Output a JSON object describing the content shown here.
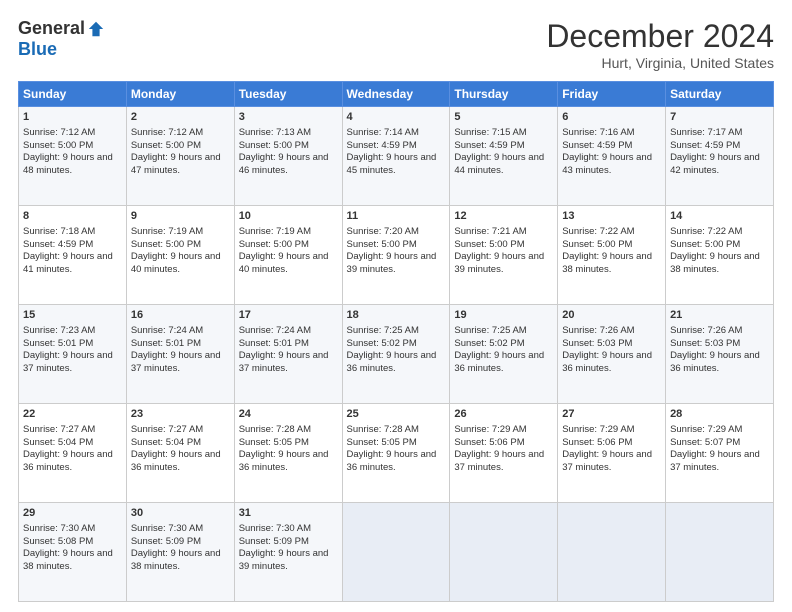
{
  "logo": {
    "general": "General",
    "blue": "Blue"
  },
  "header": {
    "month": "December 2024",
    "location": "Hurt, Virginia, United States"
  },
  "weekdays": [
    "Sunday",
    "Monday",
    "Tuesday",
    "Wednesday",
    "Thursday",
    "Friday",
    "Saturday"
  ],
  "weeks": [
    [
      {
        "day": "1",
        "sunrise": "Sunrise: 7:12 AM",
        "sunset": "Sunset: 5:00 PM",
        "daylight": "Daylight: 9 hours and 48 minutes."
      },
      {
        "day": "2",
        "sunrise": "Sunrise: 7:12 AM",
        "sunset": "Sunset: 5:00 PM",
        "daylight": "Daylight: 9 hours and 47 minutes."
      },
      {
        "day": "3",
        "sunrise": "Sunrise: 7:13 AM",
        "sunset": "Sunset: 5:00 PM",
        "daylight": "Daylight: 9 hours and 46 minutes."
      },
      {
        "day": "4",
        "sunrise": "Sunrise: 7:14 AM",
        "sunset": "Sunset: 4:59 PM",
        "daylight": "Daylight: 9 hours and 45 minutes."
      },
      {
        "day": "5",
        "sunrise": "Sunrise: 7:15 AM",
        "sunset": "Sunset: 4:59 PM",
        "daylight": "Daylight: 9 hours and 44 minutes."
      },
      {
        "day": "6",
        "sunrise": "Sunrise: 7:16 AM",
        "sunset": "Sunset: 4:59 PM",
        "daylight": "Daylight: 9 hours and 43 minutes."
      },
      {
        "day": "7",
        "sunrise": "Sunrise: 7:17 AM",
        "sunset": "Sunset: 4:59 PM",
        "daylight": "Daylight: 9 hours and 42 minutes."
      }
    ],
    [
      {
        "day": "8",
        "sunrise": "Sunrise: 7:18 AM",
        "sunset": "Sunset: 4:59 PM",
        "daylight": "Daylight: 9 hours and 41 minutes."
      },
      {
        "day": "9",
        "sunrise": "Sunrise: 7:19 AM",
        "sunset": "Sunset: 5:00 PM",
        "daylight": "Daylight: 9 hours and 40 minutes."
      },
      {
        "day": "10",
        "sunrise": "Sunrise: 7:19 AM",
        "sunset": "Sunset: 5:00 PM",
        "daylight": "Daylight: 9 hours and 40 minutes."
      },
      {
        "day": "11",
        "sunrise": "Sunrise: 7:20 AM",
        "sunset": "Sunset: 5:00 PM",
        "daylight": "Daylight: 9 hours and 39 minutes."
      },
      {
        "day": "12",
        "sunrise": "Sunrise: 7:21 AM",
        "sunset": "Sunset: 5:00 PM",
        "daylight": "Daylight: 9 hours and 39 minutes."
      },
      {
        "day": "13",
        "sunrise": "Sunrise: 7:22 AM",
        "sunset": "Sunset: 5:00 PM",
        "daylight": "Daylight: 9 hours and 38 minutes."
      },
      {
        "day": "14",
        "sunrise": "Sunrise: 7:22 AM",
        "sunset": "Sunset: 5:00 PM",
        "daylight": "Daylight: 9 hours and 38 minutes."
      }
    ],
    [
      {
        "day": "15",
        "sunrise": "Sunrise: 7:23 AM",
        "sunset": "Sunset: 5:01 PM",
        "daylight": "Daylight: 9 hours and 37 minutes."
      },
      {
        "day": "16",
        "sunrise": "Sunrise: 7:24 AM",
        "sunset": "Sunset: 5:01 PM",
        "daylight": "Daylight: 9 hours and 37 minutes."
      },
      {
        "day": "17",
        "sunrise": "Sunrise: 7:24 AM",
        "sunset": "Sunset: 5:01 PM",
        "daylight": "Daylight: 9 hours and 37 minutes."
      },
      {
        "day": "18",
        "sunrise": "Sunrise: 7:25 AM",
        "sunset": "Sunset: 5:02 PM",
        "daylight": "Daylight: 9 hours and 36 minutes."
      },
      {
        "day": "19",
        "sunrise": "Sunrise: 7:25 AM",
        "sunset": "Sunset: 5:02 PM",
        "daylight": "Daylight: 9 hours and 36 minutes."
      },
      {
        "day": "20",
        "sunrise": "Sunrise: 7:26 AM",
        "sunset": "Sunset: 5:03 PM",
        "daylight": "Daylight: 9 hours and 36 minutes."
      },
      {
        "day": "21",
        "sunrise": "Sunrise: 7:26 AM",
        "sunset": "Sunset: 5:03 PM",
        "daylight": "Daylight: 9 hours and 36 minutes."
      }
    ],
    [
      {
        "day": "22",
        "sunrise": "Sunrise: 7:27 AM",
        "sunset": "Sunset: 5:04 PM",
        "daylight": "Daylight: 9 hours and 36 minutes."
      },
      {
        "day": "23",
        "sunrise": "Sunrise: 7:27 AM",
        "sunset": "Sunset: 5:04 PM",
        "daylight": "Daylight: 9 hours and 36 minutes."
      },
      {
        "day": "24",
        "sunrise": "Sunrise: 7:28 AM",
        "sunset": "Sunset: 5:05 PM",
        "daylight": "Daylight: 9 hours and 36 minutes."
      },
      {
        "day": "25",
        "sunrise": "Sunrise: 7:28 AM",
        "sunset": "Sunset: 5:05 PM",
        "daylight": "Daylight: 9 hours and 36 minutes."
      },
      {
        "day": "26",
        "sunrise": "Sunrise: 7:29 AM",
        "sunset": "Sunset: 5:06 PM",
        "daylight": "Daylight: 9 hours and 37 minutes."
      },
      {
        "day": "27",
        "sunrise": "Sunrise: 7:29 AM",
        "sunset": "Sunset: 5:06 PM",
        "daylight": "Daylight: 9 hours and 37 minutes."
      },
      {
        "day": "28",
        "sunrise": "Sunrise: 7:29 AM",
        "sunset": "Sunset: 5:07 PM",
        "daylight": "Daylight: 9 hours and 37 minutes."
      }
    ],
    [
      {
        "day": "29",
        "sunrise": "Sunrise: 7:30 AM",
        "sunset": "Sunset: 5:08 PM",
        "daylight": "Daylight: 9 hours and 38 minutes."
      },
      {
        "day": "30",
        "sunrise": "Sunrise: 7:30 AM",
        "sunset": "Sunset: 5:09 PM",
        "daylight": "Daylight: 9 hours and 38 minutes."
      },
      {
        "day": "31",
        "sunrise": "Sunrise: 7:30 AM",
        "sunset": "Sunset: 5:09 PM",
        "daylight": "Daylight: 9 hours and 39 minutes."
      },
      null,
      null,
      null,
      null
    ]
  ]
}
